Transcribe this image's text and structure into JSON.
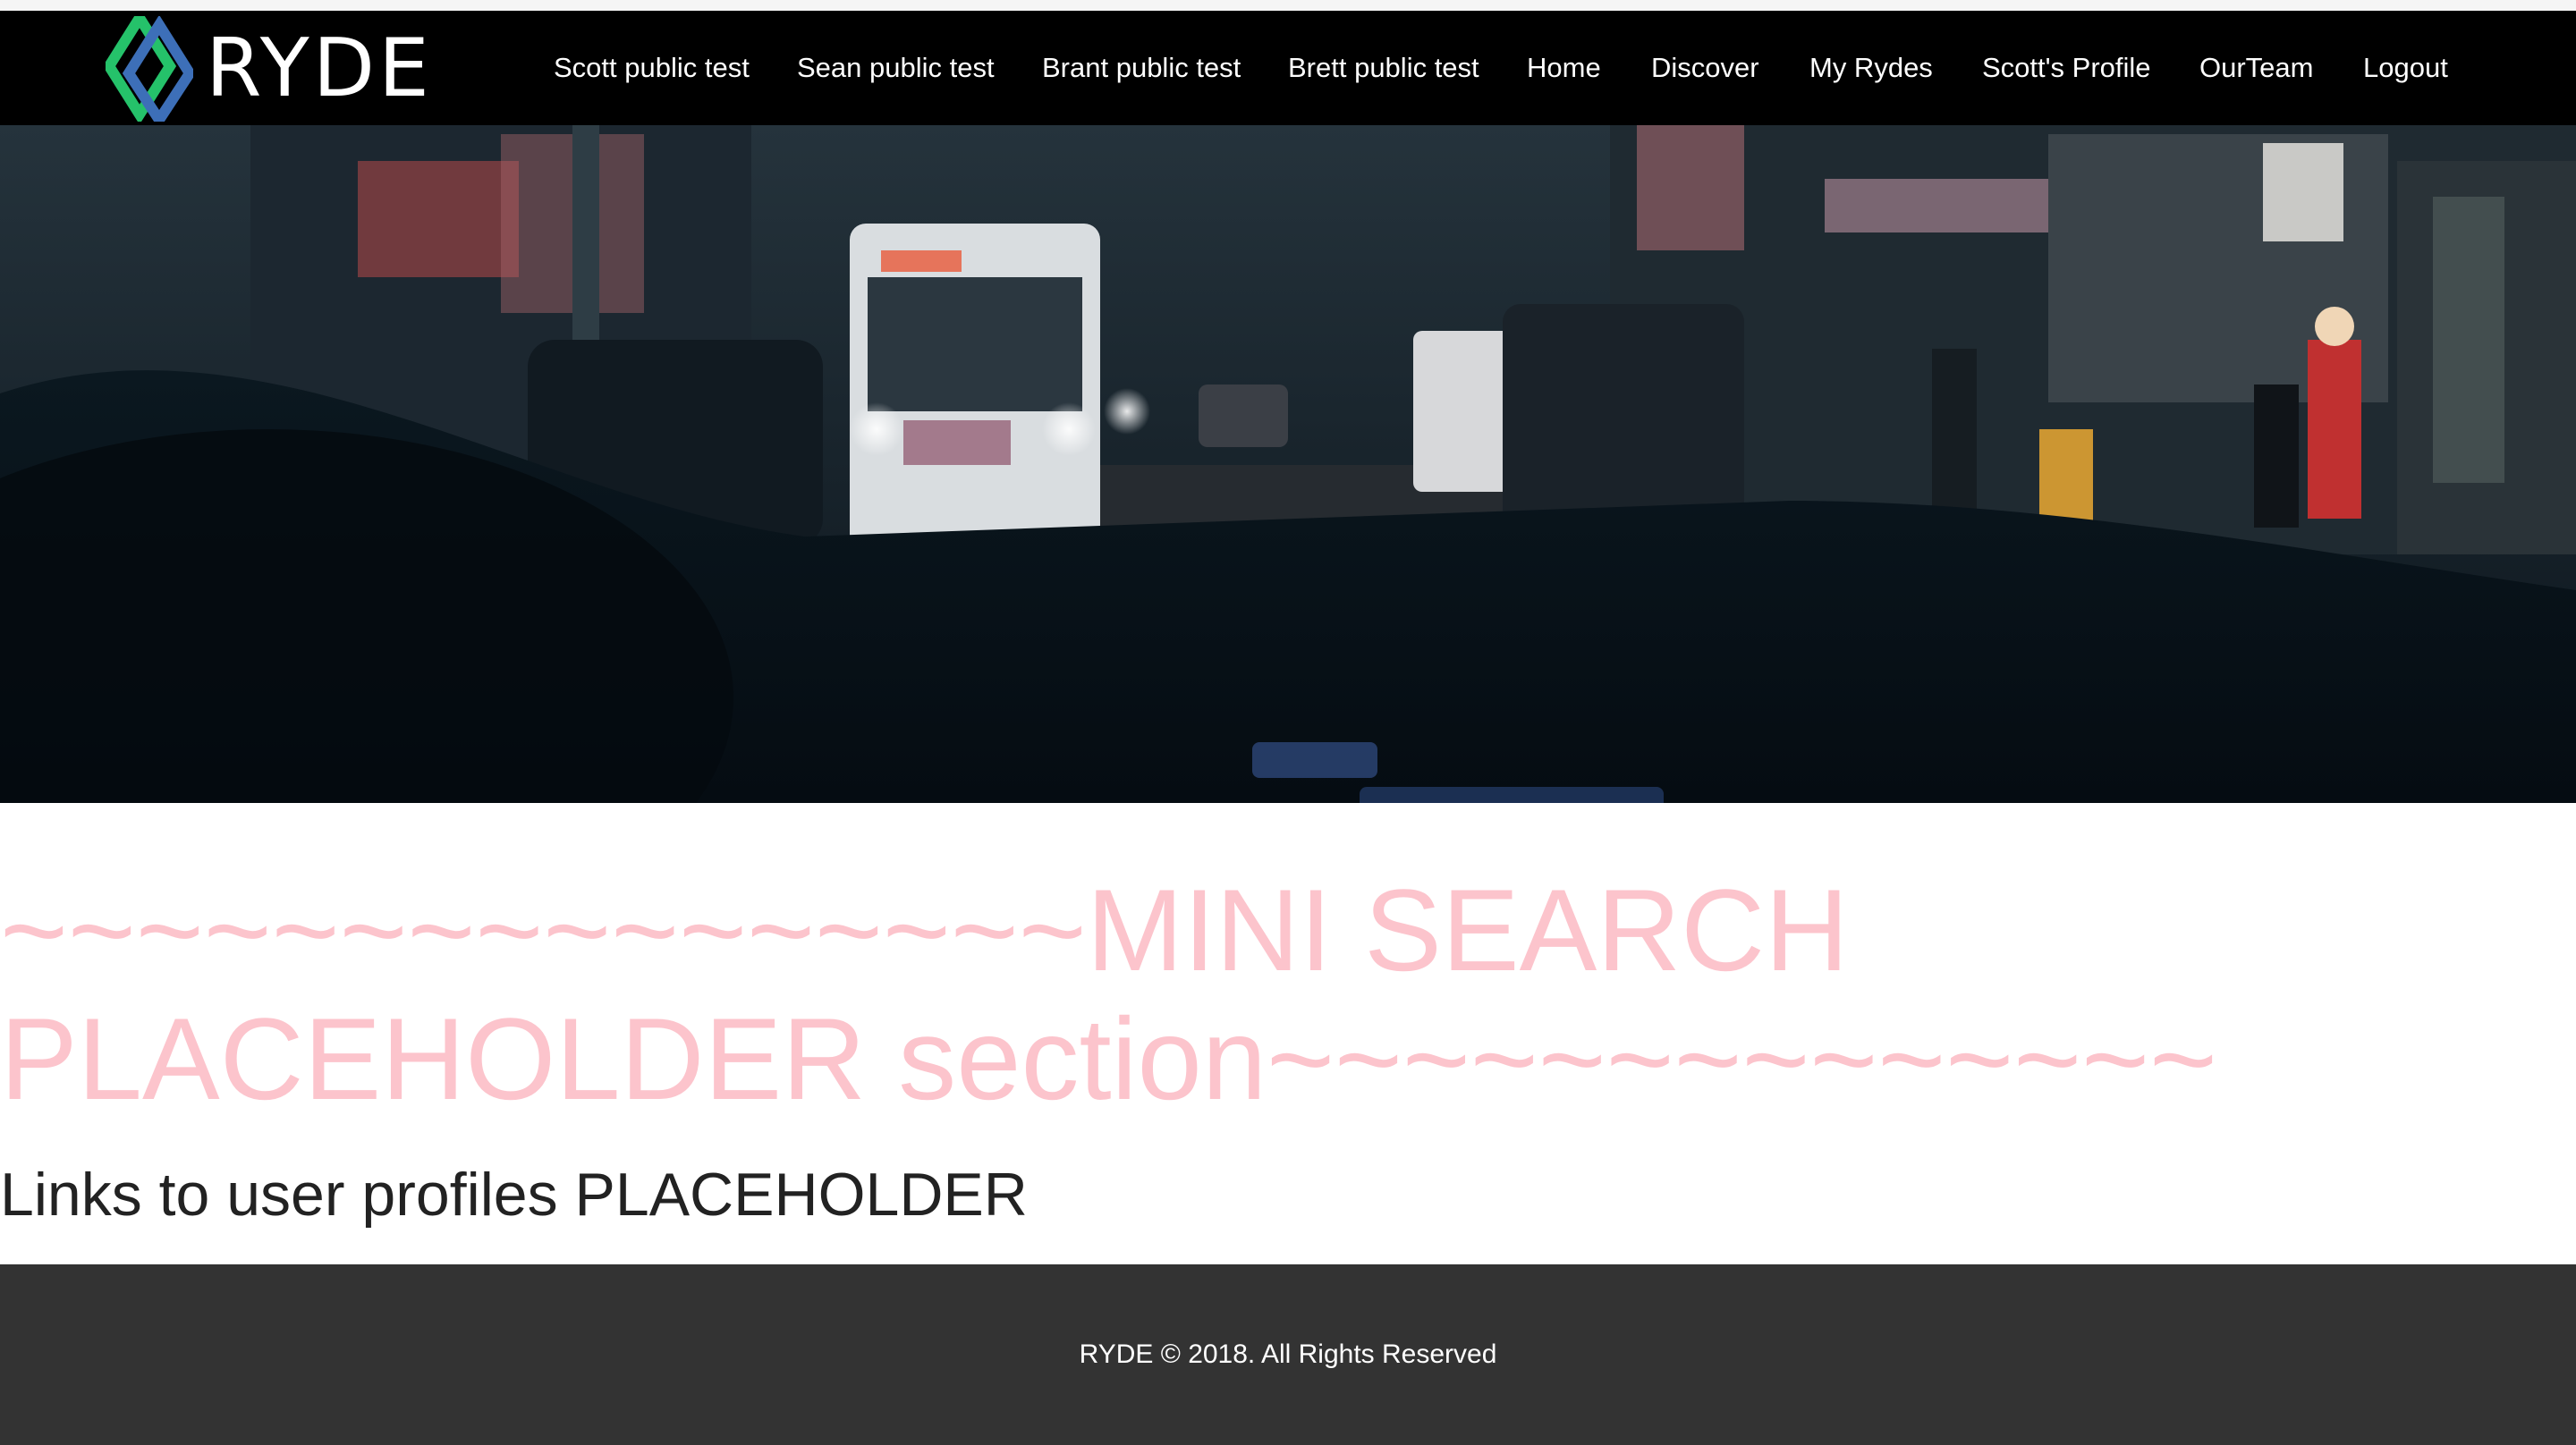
{
  "brand": {
    "logo_text": "RYDE",
    "logo_icon": "diamond-logo-icon",
    "colors": {
      "green": "#25c26a",
      "blue": "#3d6fb8",
      "navbar": "#000000"
    }
  },
  "nav": {
    "items": [
      {
        "label": "Scott public test"
      },
      {
        "label": "Sean public test"
      },
      {
        "label": "Brant public test"
      },
      {
        "label": "Brett public test"
      },
      {
        "label": "Home"
      },
      {
        "label": "Discover"
      },
      {
        "label": "My Rydes"
      },
      {
        "label": "Scott's Profile"
      },
      {
        "label": "OurTeam"
      },
      {
        "label": "Logout"
      }
    ]
  },
  "main": {
    "search_placeholder": "~~~~~~~~~~~~~~~~MINI SEARCH PLACEHOLDER section~~~~~~~~~~~~~~",
    "profiles_placeholder": "Links to user profiles PLACEHOLDER",
    "colors": {
      "placeholder_pink": "#fcc4cc"
    }
  },
  "footer": {
    "text": "RYDE © 2018. All Rights Reserved",
    "background": "#333333"
  }
}
